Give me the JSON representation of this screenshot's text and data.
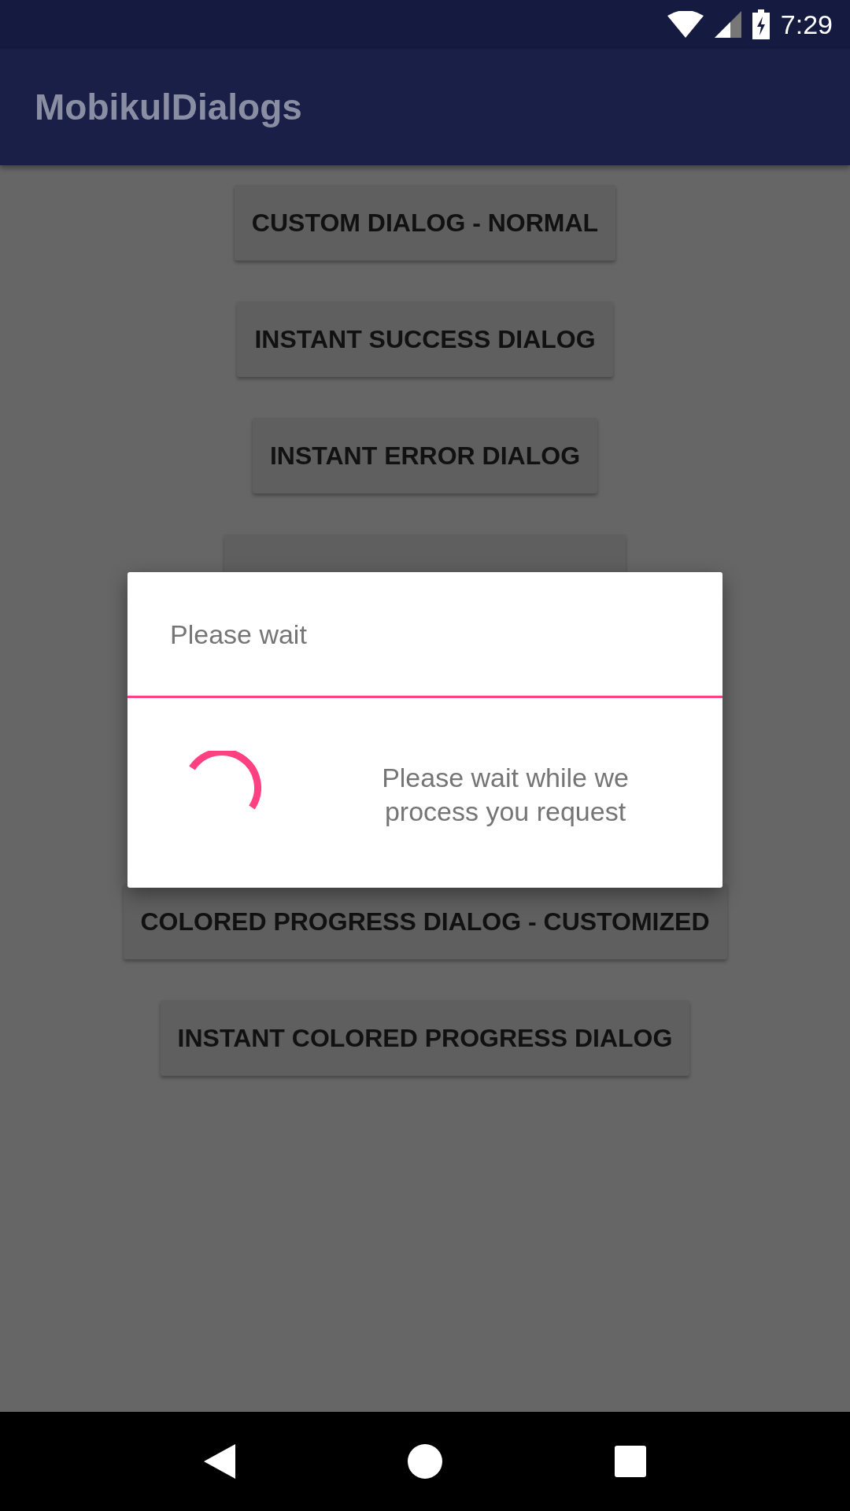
{
  "status_bar": {
    "time": "7:29"
  },
  "app_bar": {
    "title": "MobikulDialogs"
  },
  "buttons_above": [
    {
      "label": "CUSTOM DIALOG - NORMAL"
    },
    {
      "label": "INSTANT SUCCESS DIALOG"
    },
    {
      "label": "INSTANT ERROR DIALOG"
    }
  ],
  "buttons_below": [
    {
      "label": "COLORED PROGRESS DIALOG - CUSTOMIZED"
    },
    {
      "label": "INSTANT COLORED PROGRESS DIALOG"
    }
  ],
  "dialog": {
    "title": "Please wait",
    "message": "Please wait while we process you request"
  }
}
